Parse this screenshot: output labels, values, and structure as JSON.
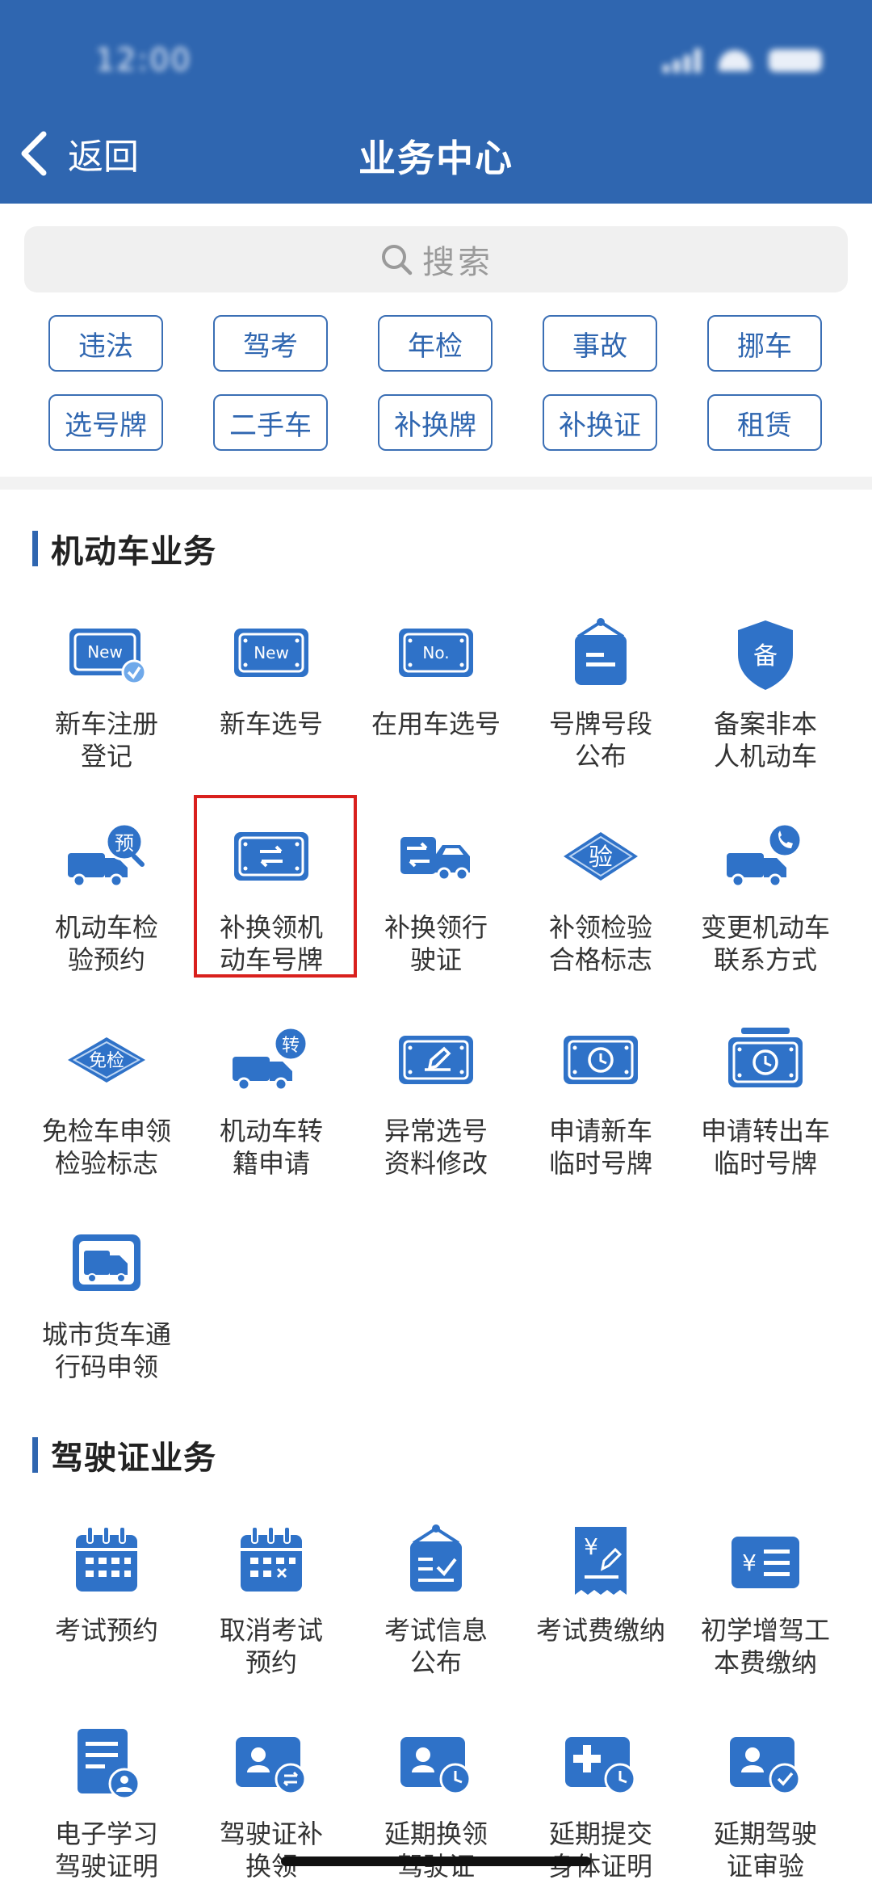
{
  "header": {
    "title": "业务中心",
    "back_label": "返回",
    "color": "#2f66b0"
  },
  "search": {
    "placeholder": "搜索"
  },
  "chips": [
    {
      "label": "违法"
    },
    {
      "label": "驾考"
    },
    {
      "label": "年检"
    },
    {
      "label": "事故"
    },
    {
      "label": "挪车"
    },
    {
      "label": "选号牌"
    },
    {
      "label": "二手车"
    },
    {
      "label": "补换牌"
    },
    {
      "label": "补换证"
    },
    {
      "label": "租赁"
    }
  ],
  "vehicle_section": {
    "title": "机动车业务",
    "items": [
      {
        "label": "新车注册\n登记",
        "icon": "new-plate-check-icon"
      },
      {
        "label": "新车选号",
        "icon": "new-plate-icon"
      },
      {
        "label": "在用车选号",
        "icon": "number-plate-icon"
      },
      {
        "label": "号牌号段\n公布",
        "icon": "signboard-icon"
      },
      {
        "label": "备案非本\n人机动车",
        "icon": "record-shield-icon"
      },
      {
        "label": "机动车检\n验预约",
        "icon": "truck-appointment-icon"
      },
      {
        "label": "补换领机\n动车号牌",
        "icon": "plate-exchange-icon"
      },
      {
        "label": "补换领行\n驶证",
        "icon": "car-exchange-icon"
      },
      {
        "label": "补领检验\n合格标志",
        "icon": "inspection-diamond-icon"
      },
      {
        "label": "变更机动车\n联系方式",
        "icon": "truck-phone-icon"
      },
      {
        "label": "免检车申领\n检验标志",
        "icon": "exempt-diamond-icon"
      },
      {
        "label": "机动车转\n籍申请",
        "icon": "truck-transfer-icon"
      },
      {
        "label": "异常选号\n资料修改",
        "icon": "plate-edit-icon"
      },
      {
        "label": "申请新车\n临时号牌",
        "icon": "temp-plate-clock-icon"
      },
      {
        "label": "申请转出车\n临时号牌",
        "icon": "temp-plate-clock-alt-icon"
      },
      {
        "label": "城市货车通\n行码申领",
        "icon": "freight-truck-icon"
      }
    ]
  },
  "license_section": {
    "title": "驾驶证业务",
    "items": [
      {
        "label": "考试预约",
        "icon": "calendar-icon"
      },
      {
        "label": "取消考试\n预约",
        "icon": "calendar-cancel-icon"
      },
      {
        "label": "考试信息\n公布",
        "icon": "notice-board-icon"
      },
      {
        "label": "考试费缴纳",
        "icon": "fee-receipt-icon"
      },
      {
        "label": "初学增驾工\n本费缴纳",
        "icon": "fee-list-icon"
      },
      {
        "label": "电子学习\n驾驶证明",
        "icon": "document-user-icon"
      },
      {
        "label": "驾驶证补\n换领",
        "icon": "license-exchange-icon"
      },
      {
        "label": "延期换领\n驾驶证",
        "icon": "license-clock-icon"
      },
      {
        "label": "延期提交\n身体证明",
        "icon": "medical-clock-icon"
      },
      {
        "label": "延期驾驶\n证审验",
        "icon": "license-check-icon"
      }
    ]
  }
}
